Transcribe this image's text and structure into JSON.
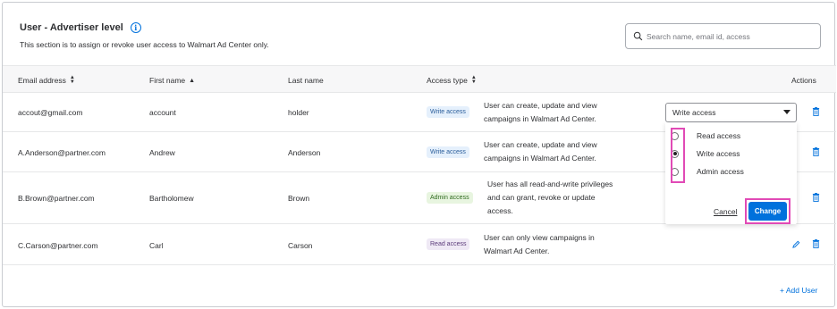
{
  "section": {
    "title": "User - Advertiser level",
    "info_icon": "info-icon",
    "subtitle": "This section is to assign or revoke user access to Walmart Ad Center only."
  },
  "search": {
    "placeholder": "Search name, email id, access"
  },
  "columns": {
    "email": "Email address",
    "first": "First name",
    "last": "Last name",
    "access": "Access type",
    "actions": "Actions"
  },
  "rows": [
    {
      "email": "accout@gmail.com",
      "first": "account",
      "last": "holder",
      "access": "Write access",
      "desc": [
        "User can create, update and view",
        "campaigns in Walmart Ad Center."
      ]
    },
    {
      "email": "A.Anderson@partner.com",
      "first": "Andrew",
      "last": "Anderson",
      "access": "Write access",
      "desc": [
        "User can create, update and view",
        "campaigns in Walmart Ad Center."
      ]
    },
    {
      "email": "B.Brown@partner.com",
      "first": "Bartholomew",
      "last": "Brown",
      "access": "Admin access",
      "desc": [
        "User has all read-and-write privileges",
        "and can grant, revoke or update",
        "access."
      ]
    },
    {
      "email": "C.Carson@partner.com",
      "first": "Carl",
      "last": "Carson",
      "access": "Read access",
      "desc": [
        "User can only view campaigns in",
        "Walmart Ad Center."
      ]
    }
  ],
  "dropdown": {
    "selected": "Write access",
    "options": [
      "Read access",
      "Write access",
      "Admin access"
    ],
    "cancel_label": "Cancel",
    "change_label": "Change"
  },
  "add_user_label": "+ Add User",
  "colors": {
    "accent": "#0071dc",
    "highlight": "#e14ab6"
  }
}
